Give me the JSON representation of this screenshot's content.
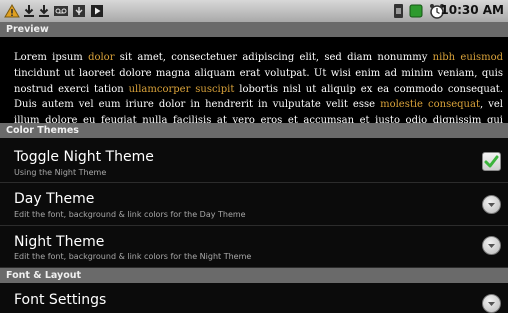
{
  "status_bar": {
    "time": "10:30 AM",
    "left_icons": [
      "alert-icon",
      "download-icon",
      "download-icon",
      "voicemail-icon",
      "usb-icon",
      "play-icon"
    ],
    "right_icons": [
      "sim-icon",
      "battery-icon",
      "alarm-icon"
    ]
  },
  "preview": {
    "header": "Preview",
    "segments": [
      {
        "text": "Lorem ipsum ",
        "link": false
      },
      {
        "text": "dolor",
        "link": true
      },
      {
        "text": " sit amet, consectetuer adipiscing elit, sed diam nonummy ",
        "link": false
      },
      {
        "text": "nibh euismod",
        "link": true
      },
      {
        "text": " tincidunt ut laoreet dolore magna aliquam erat volutpat. Ut wisi enim ad minim veniam, quis nostrud exerci tation ",
        "link": false
      },
      {
        "text": "ullamcorper suscipit",
        "link": true
      },
      {
        "text": " lobortis nisl ut aliquip ex ea commodo consequat. Duis autem vel eum iriure dolor in hendrerit in vulputate velit esse ",
        "link": false
      },
      {
        "text": "molestie consequat",
        "link": true
      },
      {
        "text": ", vel illum dolore eu feugiat nulla facilisis at vero eros et accumsan et iusto odio dignissim qui blandit praesent",
        "link": false
      }
    ]
  },
  "color_themes": {
    "header": "Color Themes",
    "toggle_night": {
      "title": "Toggle Night Theme",
      "summary": "Using the Night Theme",
      "checked": true
    },
    "day_theme": {
      "title": "Day Theme",
      "summary": "Edit the font, background & link colors for the Day Theme"
    },
    "night_theme": {
      "title": "Night Theme",
      "summary": "Edit the font, background & link colors for the Night Theme"
    }
  },
  "font_layout": {
    "header": "Font & Layout",
    "font_settings": {
      "title": "Font Settings"
    }
  },
  "colors": {
    "link": "#d9a23a",
    "check_green": "#3cb43c",
    "section_header": "#6a6a6a"
  }
}
